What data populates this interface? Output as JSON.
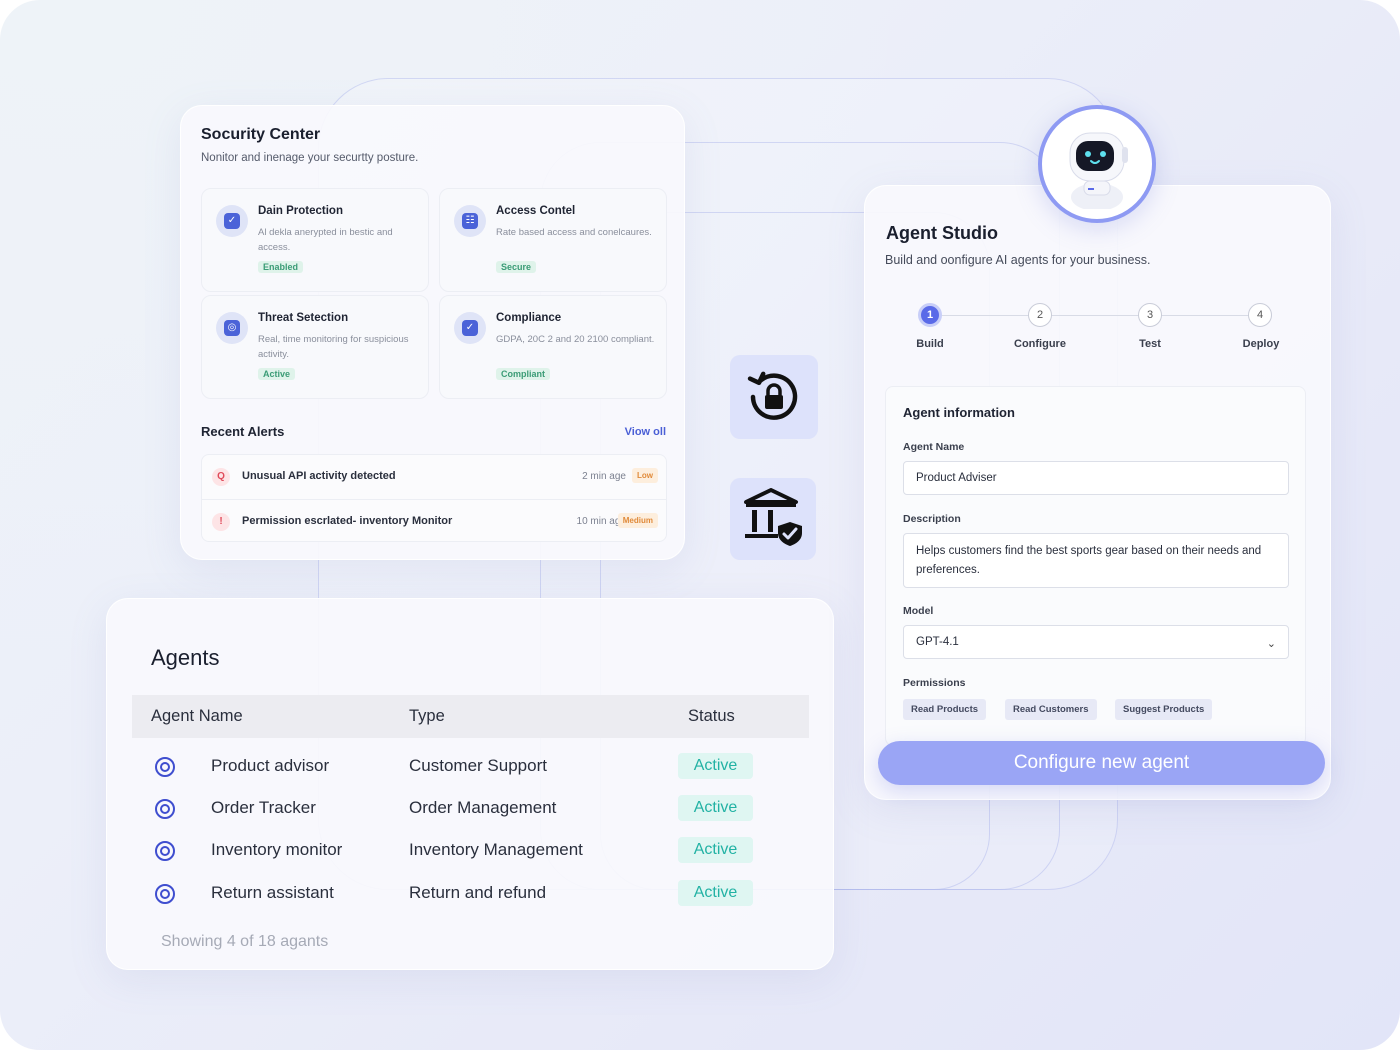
{
  "security": {
    "title": "Socurity Center",
    "subtitle": "Nonitor and inenage your securtty posture.",
    "tiles": [
      {
        "title": "Dain Protection",
        "desc": "Al dekla anerypted in bestic and access.",
        "badge": "Enabled",
        "icon": "shield-icon"
      },
      {
        "title": "Access Contel",
        "desc": "Rate based access and conelcaures.",
        "badge": "Secure",
        "icon": "users-icon"
      },
      {
        "title": "Threat Setection",
        "desc": "Real, time monitoring for suspicious activity.",
        "badge": "Active",
        "icon": "radar-icon"
      },
      {
        "title": "Compliance",
        "desc": "GDPA, 20C 2 and 20 2100 compliant.",
        "badge": "Compliant",
        "icon": "document-check-icon"
      }
    ],
    "recent_alerts_title": "Recent Alerts",
    "view_all": "Viow oll",
    "alerts": [
      {
        "text": "Unusual API activity detected",
        "time": "2 min age",
        "tag": "Low"
      },
      {
        "text": "Permission escrlated- inventory Monitor",
        "time": "10 min ago",
        "tag": "Medium"
      }
    ]
  },
  "agents": {
    "title": "Agents",
    "columns": [
      "Agent Name",
      "Type",
      "Status"
    ],
    "rows": [
      {
        "name": "Product advisor",
        "type": "Customer Support",
        "status": "Active"
      },
      {
        "name": "Order Tracker",
        "type": "Order Management",
        "status": "Active"
      },
      {
        "name": "Inventory monitor",
        "type": "Inventory Management",
        "status": "Active"
      },
      {
        "name": "Return assistant",
        "type": "Return and refund",
        "status": "Active"
      }
    ],
    "footer": "Showing 4 of 18 agants"
  },
  "studio": {
    "title": "Agent Studio",
    "subtitle": "Build and oonfigure AI agents for your business.",
    "steps": [
      {
        "num": "1",
        "label": "Build"
      },
      {
        "num": "2",
        "label": "Configure"
      },
      {
        "num": "3",
        "label": "Test"
      },
      {
        "num": "4",
        "label": "Deploy"
      }
    ],
    "active_step": 1,
    "form": {
      "heading": "Agent information",
      "name_label": "Agent Name",
      "name_value": "Product Adviser",
      "desc_label": "Description",
      "desc_value": "Helps customers find the best sports gear based on their needs and preferences.",
      "model_label": "Model",
      "model_value": "GPT-4.1",
      "permissions_label": "Permissions",
      "permissions": [
        "Read Products",
        "Read Customers",
        "Suggest Products"
      ]
    },
    "cta": "Configure new agent"
  },
  "colors": {
    "accent": "#5a6ae8",
    "cta": "#9aa5f5",
    "active_badge_bg": "#dff6f2",
    "active_badge_text": "#22b2a4"
  }
}
